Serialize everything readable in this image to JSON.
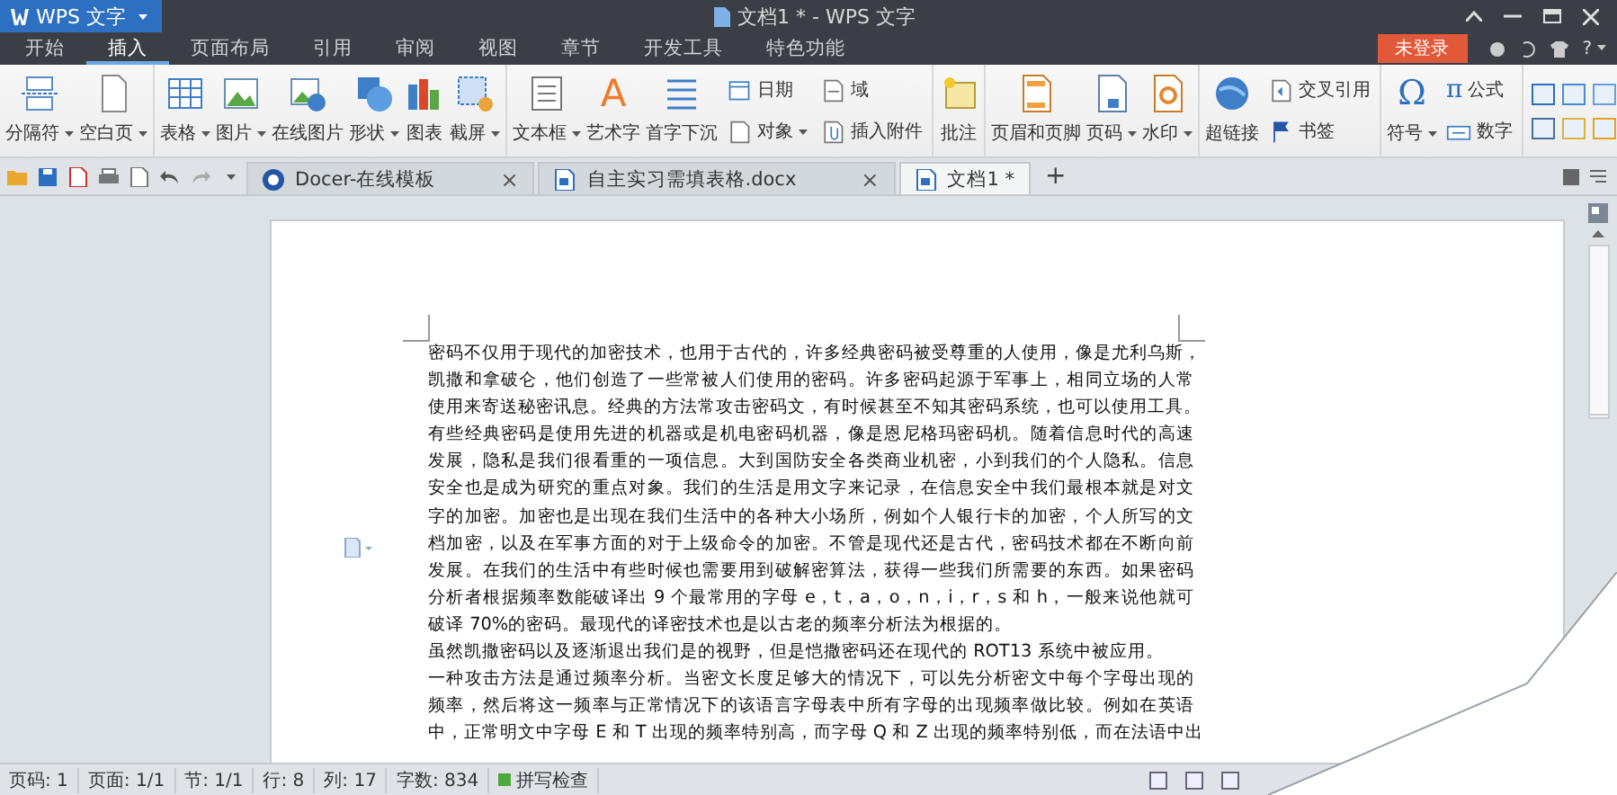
{
  "window": {
    "app_button": "WPS 文字",
    "title": "文档1 * - WPS 文字"
  },
  "menu_tabs": [
    {
      "label": "开始",
      "selected": false
    },
    {
      "label": "插入",
      "selected": true
    },
    {
      "label": "页面布局",
      "selected": false
    },
    {
      "label": "引用",
      "selected": false
    },
    {
      "label": "审阅",
      "selected": false
    },
    {
      "label": "视图",
      "selected": false
    },
    {
      "label": "章节",
      "selected": false
    },
    {
      "label": "开发工具",
      "selected": false
    },
    {
      "label": "特色功能",
      "selected": false
    }
  ],
  "login_button": "未登录",
  "help_button": "?",
  "ribbon": {
    "groups": [
      {
        "items": [
          {
            "kind": "large",
            "label": "分隔符",
            "dropdown": true
          },
          {
            "kind": "large",
            "label": "空白页",
            "dropdown": true
          }
        ]
      },
      {
        "items": [
          {
            "kind": "large",
            "label": "表格",
            "dropdown": true
          },
          {
            "kind": "large",
            "label": "图片",
            "dropdown": true
          },
          {
            "kind": "large",
            "label": "在线图片",
            "dropdown": false
          },
          {
            "kind": "large",
            "label": "形状",
            "dropdown": true
          },
          {
            "kind": "large",
            "label": "图表",
            "dropdown": false
          },
          {
            "kind": "large",
            "label": "截屏",
            "dropdown": true
          }
        ]
      },
      {
        "items": [
          {
            "kind": "large",
            "label": "文本框",
            "dropdown": true
          },
          {
            "kind": "large",
            "label": "艺术字",
            "dropdown": false,
            "glyph": "A"
          },
          {
            "kind": "large",
            "label": "首字下沉",
            "dropdown": false
          },
          {
            "kind": "stack",
            "items": [
              {
                "label": "日期",
                "dropdown": false
              },
              {
                "label": "对象",
                "dropdown": true
              }
            ]
          },
          {
            "kind": "stack",
            "items": [
              {
                "label": "域",
                "dropdown": false
              },
              {
                "label": "插入附件",
                "dropdown": false
              }
            ]
          }
        ]
      },
      {
        "items": [
          {
            "kind": "large",
            "label": "批注",
            "dropdown": false
          }
        ]
      },
      {
        "items": [
          {
            "kind": "large",
            "label": "页眉和页脚",
            "dropdown": false
          },
          {
            "kind": "large",
            "label": "页码",
            "dropdown": true
          },
          {
            "kind": "large",
            "label": "水印",
            "dropdown": true
          }
        ]
      },
      {
        "items": [
          {
            "kind": "large",
            "label": "超链接",
            "dropdown": false
          },
          {
            "kind": "stack",
            "items": [
              {
                "label": "交叉引用",
                "dropdown": false
              },
              {
                "label": "书签",
                "dropdown": false
              }
            ]
          }
        ]
      },
      {
        "items": [
          {
            "kind": "large",
            "label": "符号",
            "dropdown": true,
            "glyph": "Ω"
          },
          {
            "kind": "stack",
            "items": [
              {
                "label": "公式",
                "dropdown": false,
                "glyph": "π"
              },
              {
                "label": "数字",
                "dropdown": false
              }
            ]
          }
        ]
      }
    ]
  },
  "doc_tabs": [
    {
      "label": "Docer-在线模板",
      "selected": false,
      "close": "×"
    },
    {
      "label": "自主实习需填表格.docx",
      "selected": false,
      "close": "×"
    },
    {
      "label": "文档1 *",
      "selected": true
    }
  ],
  "new_tab": "+",
  "document": {
    "paragraphs": [
      {
        "lines": [
          "密码不仅用于现代的加密技术，也用于古代的，许多经典密码被受尊重的人使用，像是尤利乌斯，",
          "凯撒和拿破仑，他们创造了一些常被人们使用的密码。许多密码起源于军事上，相同立场的人常",
          "使用来寄送秘密讯息。经典的方法常攻击密码文，有时候甚至不知其密码系统，也可以使用工具。",
          "有些经典密码是使用先进的机器或是机电密码机器，像是恩尼格玛密码机。随着信息时代的高速",
          "发展，隐私是我们很看重的一项信息。大到国防安全各类商业机密，小到我们的个人隐私。信息",
          "安全也是成为研究的重点对象。我们的生活是用文字来记录，在信息安全中我们最根本就是对文",
          "字的加密。加密也是出现在我们生活中的各种大小场所，例如个人银行卡的加密，个人所写的文",
          "档加密，以及在军事方面的对于上级命令的加密。不管是现代还是古代，密码技术都在不断向前",
          "发展。在我们的生活中有些时候也需要用到破解密算法，获得一些我们所需要的东西。如果密码",
          "分析者根据频率数能破译出 9 个最常用的字母 e，t，a，o，n，i，r，s 和 h，一般来说他就可",
          "破译 70%的密码。最现代的译密技术也是以古老的频率分析法为根据的。"
        ]
      },
      {
        "lines": [
          "虽然凯撒密码以及逐渐退出我们是的视野，但是恺撒密码还在现代的 ROT13 系统中被应用。"
        ]
      },
      {
        "lines": [
          "一种攻击方法是通过频率分析。当密文长度足够大的情况下，可以先分析密文中每个字母出现的",
          "频率，然后将这一频率与正常情况下的该语言字母表中所有字母的出现频率做比较。例如在英语",
          "中，正常明文中字母 E 和 T 出现的频率特别高，而字母 Q 和 Z 出现的频率特别低，而在法语中出"
        ]
      }
    ]
  },
  "status_bar": {
    "items": [
      "页码: 1",
      "页面: 1/1",
      "节: 1/1",
      "行: 8",
      "列: 17",
      "字数: 834"
    ],
    "spell_check": {
      "label": "拼写检查",
      "on": true
    }
  }
}
